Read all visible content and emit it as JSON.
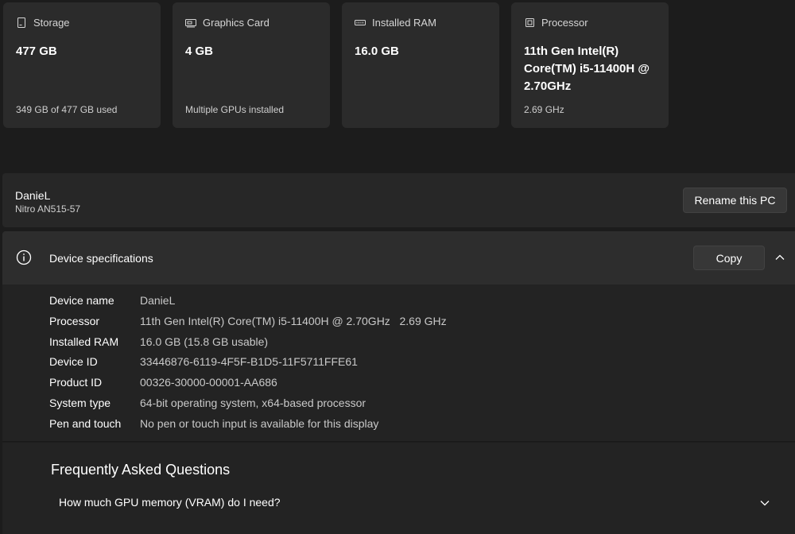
{
  "cards": [
    {
      "title": "Storage",
      "icon": "storage-icon",
      "value": "477 GB",
      "sub": "349 GB of 477 GB used"
    },
    {
      "title": "Graphics Card",
      "icon": "graphics-card-icon",
      "value": "4 GB",
      "sub": "Multiple GPUs installed"
    },
    {
      "title": "Installed RAM",
      "icon": "ram-icon",
      "value": "16.0 GB",
      "sub": ""
    },
    {
      "title": "Processor",
      "icon": "processor-icon",
      "value": "11th Gen Intel(R) Core(TM) i5-11400H @ 2.70GHz",
      "sub": "2.69 GHz"
    }
  ],
  "pc": {
    "name": "DanieL",
    "model": "Nitro AN515-57",
    "rename_label": "Rename this PC"
  },
  "specs": {
    "title": "Device specifications",
    "copy_label": "Copy",
    "rows": [
      {
        "label": "Device name",
        "value": "DanieL"
      },
      {
        "label": "Processor",
        "value": "11th Gen Intel(R) Core(TM) i5-11400H @ 2.70GHz   2.69 GHz"
      },
      {
        "label": "Installed RAM",
        "value": "16.0 GB (15.8 GB usable)"
      },
      {
        "label": "Device ID",
        "value": "33446876-6119-4F5F-B1D5-11F5711FFE61"
      },
      {
        "label": "Product ID",
        "value": "00326-30000-00001-AA686"
      },
      {
        "label": "System type",
        "value": "64-bit operating system, x64-based processor"
      },
      {
        "label": "Pen and touch",
        "value": "No pen or touch input is available for this display"
      }
    ]
  },
  "faq": {
    "title": "Frequently Asked Questions",
    "questions": [
      "How much GPU memory (VRAM) do I need?"
    ]
  },
  "colors": {
    "background": "#1c1c1c",
    "card": "#2b2b2b",
    "button": "#373737"
  }
}
